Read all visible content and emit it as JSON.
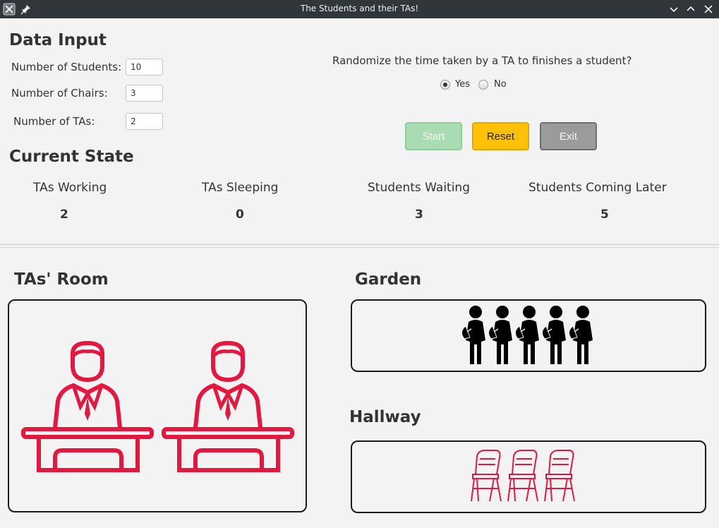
{
  "window": {
    "title": "The Students and their TAs!"
  },
  "data_input": {
    "heading": "Data Input",
    "students_label": "Number of Students:",
    "students_value": "10",
    "chairs_label": "Number of Chairs:",
    "chairs_value": "3",
    "tas_label": "Number of TAs:",
    "tas_value": "2"
  },
  "randomize": {
    "question": "Randomize the time taken by a TA to finishes a student?",
    "yes_label": "Yes",
    "no_label": "No",
    "selected": "Yes"
  },
  "buttons": {
    "start": "Start",
    "reset": "Reset",
    "exit": "Exit"
  },
  "current_state": {
    "heading": "Current State",
    "tas_working_label": "TAs Working",
    "tas_working_value": "2",
    "tas_sleeping_label": "TAs Sleeping",
    "tas_sleeping_value": "0",
    "students_waiting_label": "Students Waiting",
    "students_waiting_value": "3",
    "students_later_label": "Students Coming Later",
    "students_later_value": "5"
  },
  "rooms": {
    "tas_room": "TAs' Room",
    "garden": "Garden",
    "hallway": "Hallway"
  },
  "colors": {
    "accent_red": "#e5173f",
    "start_bg": "#a9dcb3",
    "reset_bg": "#ffc108",
    "exit_bg": "#9b9b9b"
  },
  "icons": {
    "ta_icon": "teacher-at-desk-icon",
    "student_icon": "student-icon",
    "chair_icon": "chair-icon"
  }
}
